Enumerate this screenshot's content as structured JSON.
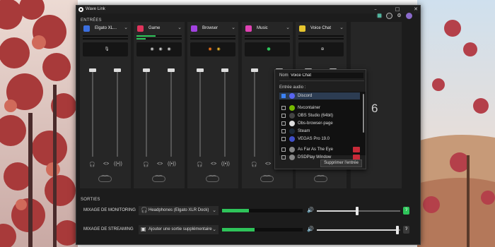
{
  "window": {
    "title": "Wave Link",
    "controls": {
      "minimize": "–",
      "maximize": "□",
      "close": "✕"
    }
  },
  "sections": {
    "inputs": "ENTRÉES",
    "outputs": "SORTIES"
  },
  "top_icons": [
    "connect-icon",
    "headset-icon",
    "gear-icon",
    "profile-avatar"
  ],
  "channels": [
    {
      "name": "Elgato XL...",
      "icon": "mic-icon",
      "color": "#3b6fe0",
      "meter": [
        0,
        0
      ],
      "apps": [
        "mic-icon"
      ],
      "fader_levels": [
        1.0,
        1.0
      ]
    },
    {
      "name": "Game",
      "icon": "gamepad-icon",
      "color": "#e0335b",
      "meter": [
        0.42,
        0.2
      ],
      "apps": [
        "game-app-icon-1",
        "game-app-icon-2",
        "game-app-icon-3"
      ],
      "fader_levels": [
        1.0,
        1.0
      ]
    },
    {
      "name": "Browser",
      "icon": "browser-icon",
      "color": "#a242e0",
      "meter": [
        0,
        0
      ],
      "apps": [
        "firefox-icon",
        "chrome-icon"
      ],
      "fader_levels": [
        1.0,
        1.0
      ]
    },
    {
      "name": "Music",
      "icon": "music-icon",
      "color": "#e042b4",
      "meter": [
        0,
        0
      ],
      "apps": [
        "spotify-icon"
      ],
      "fader_levels": [
        1.0,
        1.0
      ]
    },
    {
      "name": "Voice Chat",
      "icon": "voice-chat-icon",
      "color": "#e6c52e",
      "meter": [
        0,
        0
      ],
      "apps": [
        "add-icon"
      ],
      "fader_levels": [
        1.0,
        1.0
      ]
    }
  ],
  "extra_channel_number": "6",
  "popup": {
    "name_label": "Nom :",
    "name_value": "Voice Chat",
    "audio_input_label": "Entrée audio :",
    "items": [
      {
        "label": "Discord",
        "checked": true,
        "icon": "discord-icon",
        "color": "#5865f2"
      },
      {
        "label": "Nvcontainer",
        "checked": false,
        "icon": "nvidia-icon",
        "color": "#76b900"
      },
      {
        "label": "OBS Studio (64bit)",
        "checked": false,
        "icon": "obs-icon",
        "color": "#444444"
      },
      {
        "label": "Obs-browser-page",
        "checked": false,
        "icon": "obs-browser-icon",
        "color": "#dddddd"
      },
      {
        "label": "Steam",
        "checked": false,
        "icon": "steam-icon",
        "color": "#1b2838"
      },
      {
        "label": "VEGAS Pro 19.0",
        "checked": false,
        "icon": "vegas-icon",
        "color": "#3f4fc9"
      },
      {
        "label": "As Far As The Eye",
        "checked": false,
        "icon": "game-icon",
        "color": "#888888",
        "tagged": true
      },
      {
        "label": "DSDPlay Window",
        "checked": false,
        "icon": "app-icon",
        "color": "#888888",
        "tagged": true
      }
    ],
    "delete_button": "Supprimer l'entrée"
  },
  "outputs": [
    {
      "label": "MIXAGE DE MONITORING",
      "device": "Headphones (Elgato XLR Dock)",
      "device_icon": "headphones-icon",
      "meter": 0.33,
      "volume": 0.5,
      "end_icon": "ear-icon",
      "end_color": "#2ec45a"
    },
    {
      "label": "MIXAGE DE STREAMING",
      "device": "Ajouter une sortie supplémentaire",
      "device_icon": "output-device-icon",
      "meter": 0.4,
      "volume": 1.0,
      "end_icon": "ear-icon",
      "end_color": "#3a3a3a"
    }
  ]
}
